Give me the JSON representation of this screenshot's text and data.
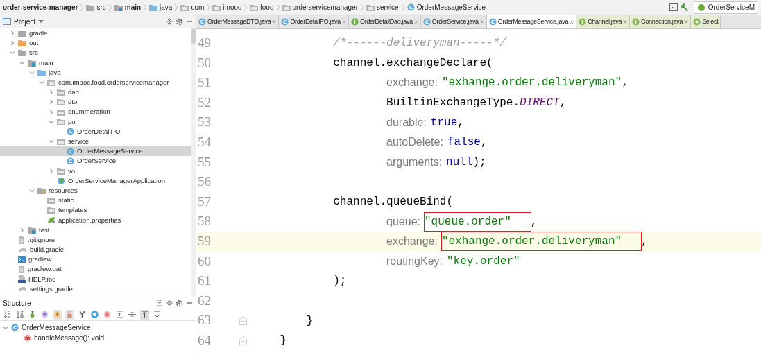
{
  "breadcrumb": [
    {
      "label": "order-service-manager",
      "kind": "none",
      "bold": true
    },
    {
      "label": "src",
      "kind": "folder",
      "bold": false
    },
    {
      "label": "main",
      "kind": "source-folder",
      "bold": true
    },
    {
      "label": "java",
      "kind": "blue-folder",
      "bold": false
    },
    {
      "label": "com",
      "kind": "package",
      "bold": false
    },
    {
      "label": "imooc",
      "kind": "package",
      "bold": false
    },
    {
      "label": "food",
      "kind": "package",
      "bold": false
    },
    {
      "label": "orderservicemanager",
      "kind": "package",
      "bold": false
    },
    {
      "label": "service",
      "kind": "package",
      "bold": false
    },
    {
      "label": "OrderMessageService",
      "kind": "class",
      "bold": false
    }
  ],
  "run_config": "OrderServiceM",
  "project_panel": {
    "title": "Project",
    "tree": [
      {
        "label": "gradle",
        "kind": "folder",
        "expanded": false,
        "selected": false
      },
      {
        "label": "out",
        "kind": "excluded-folder",
        "expanded": false,
        "selected": false
      },
      {
        "label": "src",
        "kind": "folder",
        "expanded": true,
        "selected": false,
        "children": [
          {
            "label": "main",
            "kind": "source-folder",
            "expanded": true,
            "selected": false,
            "children": [
              {
                "label": "java",
                "kind": "blue-folder",
                "expanded": true,
                "selected": false,
                "children": [
                  {
                    "label": "com.imooc.food.orderservicemanager",
                    "kind": "package",
                    "expanded": true,
                    "selected": false,
                    "children": [
                      {
                        "label": "dao",
                        "kind": "package",
                        "expanded": false,
                        "selected": false
                      },
                      {
                        "label": "dto",
                        "kind": "package",
                        "expanded": false,
                        "selected": false
                      },
                      {
                        "label": "enummeration",
                        "kind": "package",
                        "expanded": false,
                        "selected": false
                      },
                      {
                        "label": "po",
                        "kind": "package",
                        "expanded": true,
                        "selected": false,
                        "children": [
                          {
                            "label": "OrderDetailPO",
                            "kind": "class",
                            "selected": false
                          }
                        ]
                      },
                      {
                        "label": "service",
                        "kind": "package",
                        "expanded": true,
                        "selected": false,
                        "children": [
                          {
                            "label": "OrderMessageService",
                            "kind": "class",
                            "selected": true
                          },
                          {
                            "label": "OrderService",
                            "kind": "class",
                            "selected": false
                          }
                        ]
                      },
                      {
                        "label": "vo",
                        "kind": "package",
                        "expanded": false,
                        "selected": false
                      },
                      {
                        "label": "OrderServiceManagerApplication",
                        "kind": "spring-class",
                        "selected": false
                      }
                    ]
                  }
                ]
              },
              {
                "label": "resources",
                "kind": "resources-folder",
                "expanded": true,
                "selected": false,
                "children": [
                  {
                    "label": "static",
                    "kind": "package",
                    "selected": false
                  },
                  {
                    "label": "templates",
                    "kind": "package",
                    "selected": false
                  },
                  {
                    "label": "application.properties",
                    "kind": "spring-leaf",
                    "selected": false
                  }
                ]
              }
            ]
          },
          {
            "label": "test",
            "kind": "source-folder",
            "expanded": false,
            "selected": false
          }
        ]
      },
      {
        "label": ".gitignore",
        "kind": "text-file",
        "selected": false
      },
      {
        "label": "build.gradle",
        "kind": "gradle-file",
        "selected": false
      },
      {
        "label": "gradlew",
        "kind": "shell-file",
        "selected": false
      },
      {
        "label": "gradlew.bat",
        "kind": "text-file",
        "selected": false
      },
      {
        "label": "HELP.md",
        "kind": "md-file",
        "selected": false
      },
      {
        "label": "settings.gradle",
        "kind": "gradle-file",
        "selected": false
      }
    ]
  },
  "structure_panel": {
    "title": "Structure",
    "tree": [
      {
        "label": "OrderMessageService",
        "kind": "class",
        "expanded": true,
        "children": [
          {
            "label": "handleMessage(): void",
            "kind": "method"
          }
        ]
      }
    ]
  },
  "tabs": [
    {
      "label": "OrderMessageDTO.java",
      "kind": "class",
      "selected": false
    },
    {
      "label": "OrderDetailPO.java",
      "kind": "class",
      "selected": false
    },
    {
      "label": "OrderDetailDao.java",
      "kind": "interface",
      "selected": false
    },
    {
      "label": "OrderService.java",
      "kind": "class",
      "selected": false
    },
    {
      "label": "OrderMessageService.java",
      "kind": "class",
      "selected": true
    },
    {
      "label": "Channel.java",
      "kind": "library-interface",
      "selected": false
    },
    {
      "label": "Connection.java",
      "kind": "library-interface",
      "selected": false
    },
    {
      "label": "Select",
      "kind": "library-class",
      "selected": false
    }
  ],
  "code_lines": [
    {
      "number": "49",
      "current": false,
      "tokens": [
        {
          "kind": "comment",
          "text": "            /*------deliveryman-----*/"
        }
      ]
    },
    {
      "number": "50",
      "current": false,
      "tokens": [
        {
          "kind": "plain",
          "text": "            channel.exchangeDeclare("
        }
      ]
    },
    {
      "number": "51",
      "current": false,
      "tokens": [
        {
          "kind": "hint",
          "text": "                    exchange:"
        },
        {
          "kind": "string",
          "text": "\"exhange.order.deliveryman\"",
          "boxed": false
        },
        {
          "kind": "plain",
          "text": ","
        }
      ]
    },
    {
      "number": "52",
      "current": false,
      "tokens": [
        {
          "kind": "plain",
          "text": "                    BuiltinExchangeType."
        },
        {
          "kind": "constant",
          "text": "DIRECT"
        },
        {
          "kind": "plain",
          "text": ","
        }
      ]
    },
    {
      "number": "53",
      "current": false,
      "tokens": [
        {
          "kind": "hint",
          "text": "                    durable:"
        },
        {
          "kind": "keyword",
          "text": "true"
        },
        {
          "kind": "plain",
          "text": ","
        }
      ]
    },
    {
      "number": "54",
      "current": false,
      "tokens": [
        {
          "kind": "hint",
          "text": "                    autoDelete:"
        },
        {
          "kind": "keyword",
          "text": "false"
        },
        {
          "kind": "plain",
          "text": ","
        }
      ]
    },
    {
      "number": "55",
      "current": false,
      "tokens": [
        {
          "kind": "hint",
          "text": "                    arguments:"
        },
        {
          "kind": "keyword",
          "text": "null"
        },
        {
          "kind": "plain",
          "text": ");"
        }
      ]
    },
    {
      "number": "56",
      "current": false
    },
    {
      "number": "57",
      "current": false,
      "tokens": [
        {
          "kind": "plain",
          "text": "            channel.queueBind("
        }
      ]
    },
    {
      "number": "58",
      "current": false,
      "tokens": [
        {
          "kind": "hint",
          "text": "                    queue:"
        },
        {
          "kind": "string",
          "text": "\"queue.order\"",
          "boxed": true
        },
        {
          "kind": "plain",
          "text": ","
        }
      ]
    },
    {
      "number": "59",
      "current": true,
      "tokens": [
        {
          "kind": "hint",
          "text": "                    exchange:"
        },
        {
          "kind": "string",
          "text": "\"exhange.order.deliveryman\"",
          "boxed": true
        },
        {
          "kind": "plain",
          "text": ","
        }
      ]
    },
    {
      "number": "60",
      "current": false,
      "tokens": [
        {
          "kind": "hint",
          "text": "                    routingKey:"
        },
        {
          "kind": "string",
          "text": "\"key.order\"",
          "boxed": false
        }
      ]
    },
    {
      "number": "61",
      "current": false,
      "tokens": [
        {
          "kind": "plain",
          "text": "            );"
        }
      ]
    },
    {
      "number": "62",
      "current": false
    },
    {
      "number": "63",
      "current": false,
      "tokens": [
        {
          "kind": "plain",
          "text": "        }"
        }
      ]
    },
    {
      "number": "64",
      "current": false,
      "tokens": [
        {
          "kind": "plain",
          "text": "    }"
        }
      ]
    }
  ]
}
